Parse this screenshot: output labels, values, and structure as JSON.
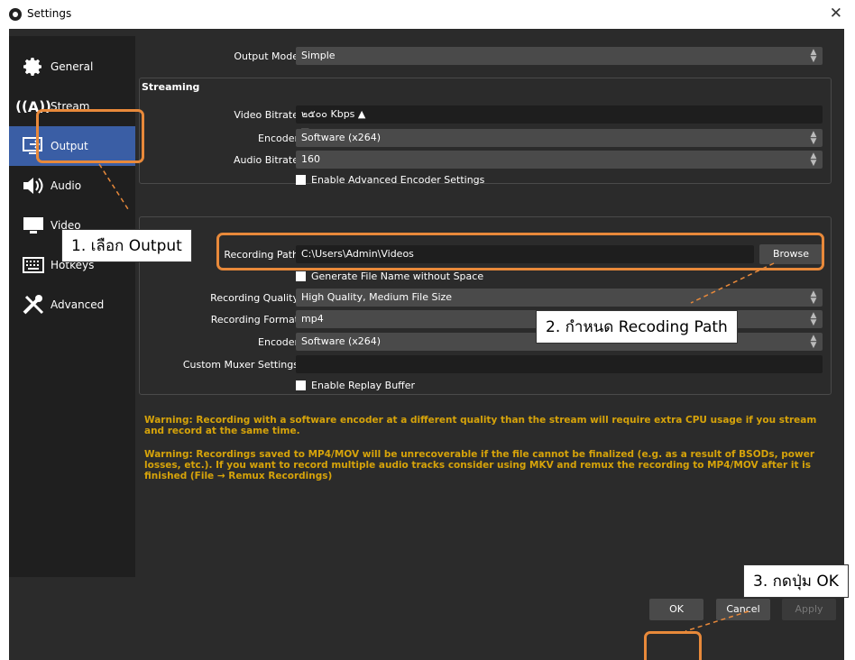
{
  "window": {
    "title": "Settings",
    "close_glyph": "✕"
  },
  "sidebar": {
    "items": [
      {
        "label": "General",
        "icon": "gear-icon"
      },
      {
        "label": "Stream",
        "icon": "broadcast-icon"
      },
      {
        "label": "Output",
        "icon": "output-icon"
      },
      {
        "label": "Audio",
        "icon": "speaker-icon"
      },
      {
        "label": "Video",
        "icon": "monitor-icon"
      },
      {
        "label": "Hotkeys",
        "icon": "keyboard-icon"
      },
      {
        "label": "Advanced",
        "icon": "tools-icon"
      }
    ],
    "active": "Output"
  },
  "output_mode": {
    "label": "Output Mode",
    "value": "Simple"
  },
  "streaming": {
    "title": "Streaming",
    "video_bitrate": {
      "label": "Video Bitrate",
      "value": "๒๕๐๐ Kbps"
    },
    "encoder": {
      "label": "Encoder",
      "value": "Software (x264)"
    },
    "audio_bitrate": {
      "label": "Audio Bitrate",
      "value": "160"
    },
    "advanced_checkbox": "Enable Advanced Encoder Settings"
  },
  "recording": {
    "path": {
      "label": "Recording Path",
      "value": "C:\\Users\\Admin\\Videos",
      "browse": "Browse"
    },
    "no_space_checkbox": "Generate File Name without Space",
    "quality": {
      "label": "Recording Quality",
      "value": "High Quality, Medium File Size"
    },
    "format": {
      "label": "Recording Format",
      "value": "mp4"
    },
    "encoder": {
      "label": "Encoder",
      "value": "Software (x264)"
    },
    "muxer": {
      "label": "Custom Muxer Settings",
      "value": ""
    },
    "replay_checkbox": "Enable Replay Buffer"
  },
  "warnings": [
    "Warning: Recording with a software encoder at a different quality than the stream will require extra CPU usage if you stream and record at the same time.",
    "Warning: Recordings saved to MP4/MOV will be unrecoverable if the file cannot be finalized (e.g. as a result of BSODs, power losses, etc.). If you want to record multiple audio tracks consider using MKV and remux the recording to MP4/MOV after it is finished (File → Remux Recordings)"
  ],
  "buttons": {
    "ok": "OK",
    "cancel": "Cancel",
    "apply": "Apply"
  },
  "annotations": {
    "step1": "1. เลือก Output",
    "step2": "2. กำหนด Recoding Path",
    "step3": "3. กดปุ่ม OK",
    "color": "#e8893a"
  },
  "colors": {
    "window_bg": "#2b2b2b",
    "sidebar_bg": "#1f1f1f",
    "active_item": "#3a5ea5",
    "warning_text": "#d6a30a"
  }
}
